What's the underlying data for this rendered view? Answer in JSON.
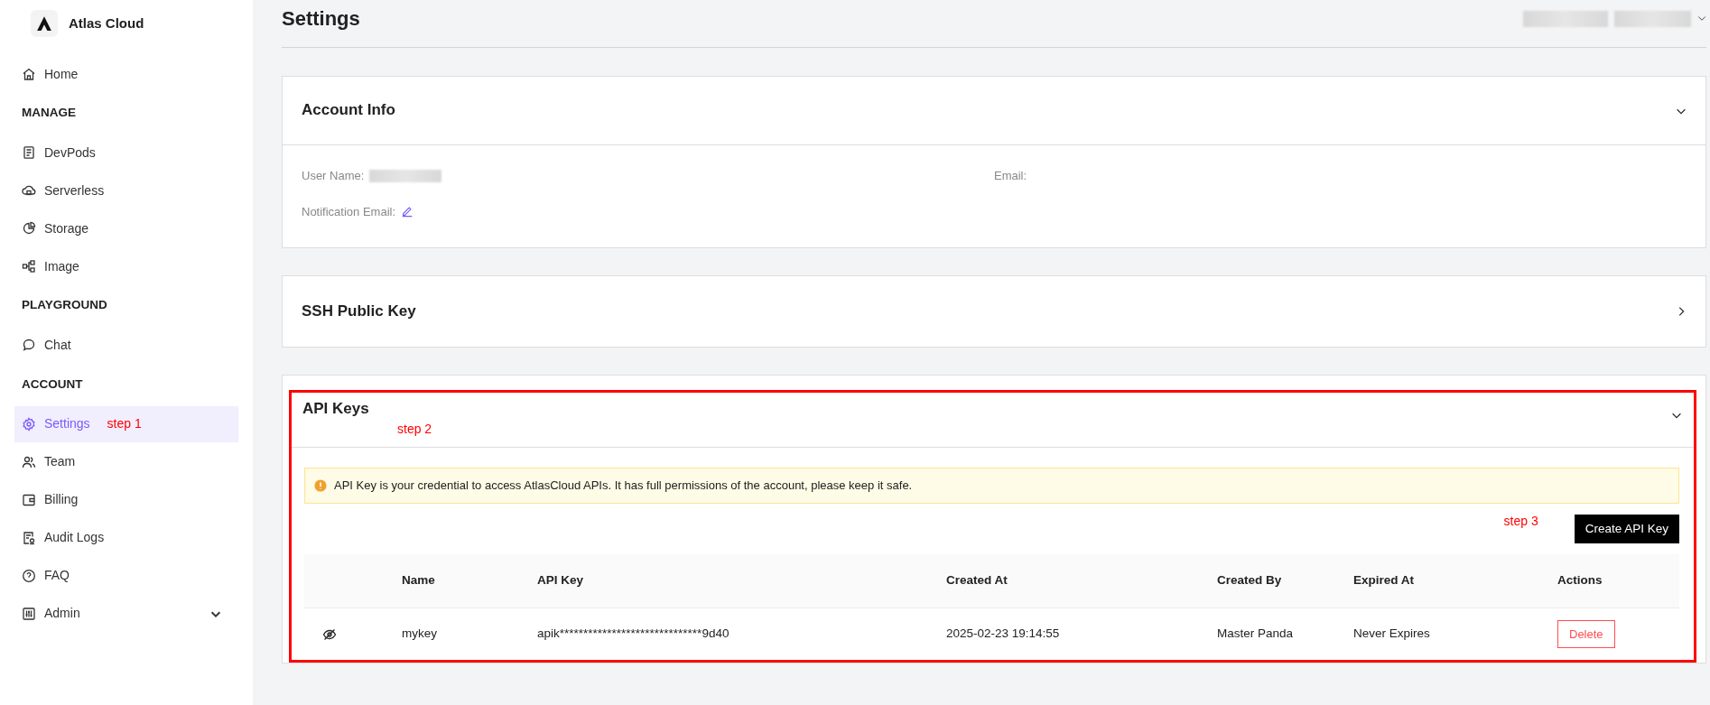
{
  "sidebar": {
    "brand": "Atlas Cloud",
    "sections": [
      {
        "items": [
          {
            "label": "Home",
            "selected": false
          }
        ]
      },
      {
        "heading": "MANAGE",
        "items": [
          {
            "label": "DevPods",
            "selected": false
          },
          {
            "label": "Serverless",
            "selected": false
          },
          {
            "label": "Storage",
            "selected": false
          },
          {
            "label": "Image",
            "selected": false
          }
        ]
      },
      {
        "heading": "PLAYGROUND",
        "items": [
          {
            "label": "Chat",
            "selected": false
          }
        ]
      },
      {
        "heading": "ACCOUNT",
        "items": [
          {
            "label": "Settings",
            "selected": true,
            "note": "step 1"
          },
          {
            "label": "Team",
            "selected": false
          },
          {
            "label": "Billing",
            "selected": false
          },
          {
            "label": "Audit Logs",
            "selected": false
          },
          {
            "label": "FAQ",
            "selected": false
          },
          {
            "label": "Admin",
            "selected": false,
            "expanded": false
          }
        ]
      }
    ]
  },
  "header": {
    "title": "Settings"
  },
  "panels": [
    {
      "kind": "account",
      "title": "Account Info",
      "expanded": true,
      "fields": [
        {
          "label": "User Name:",
          "redacted": true
        },
        {
          "label": "Email:"
        },
        {
          "label": "Notification Email:",
          "editable": true
        }
      ]
    },
    {
      "kind": "ssh",
      "title": "SSH Public Key",
      "expanded": false
    },
    {
      "kind": "api",
      "title": "API Keys",
      "expanded": true,
      "highlighted": true,
      "note": "step 2",
      "alert": "API Key is your credential to access AtlasCloud APIs. It has full permissions of the account, please keep it safe.",
      "create_button": "Create API Key",
      "create_note": "step 3",
      "table": {
        "columns": [
          "Name",
          "API Key",
          "Created At",
          "Created By",
          "Expired At",
          "Actions"
        ],
        "rows": [
          {
            "revealed": false,
            "cells": [
              "mykey",
              "apik******************************9d40",
              "2025-02-23 19:14:55",
              "Master Panda",
              "Never Expires"
            ],
            "action": "Delete"
          }
        ]
      }
    }
  ]
}
